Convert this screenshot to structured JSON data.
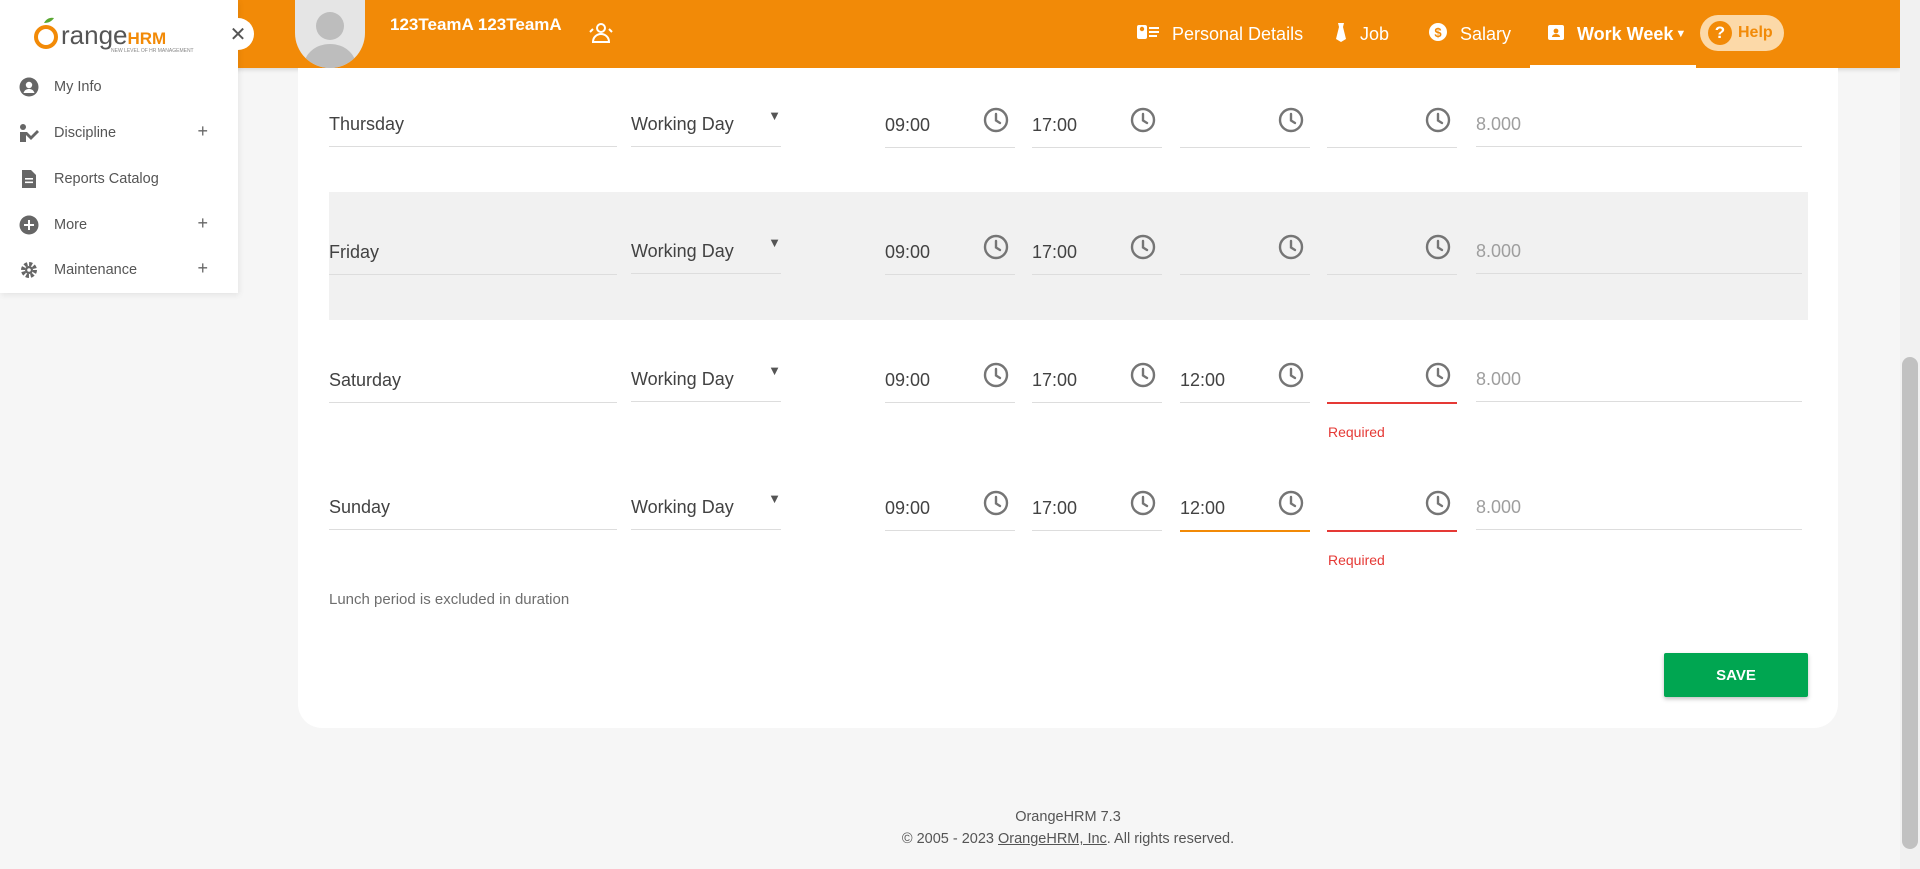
{
  "header": {
    "employee_name": "123TeamA 123TeamA",
    "nav": [
      {
        "label": "Personal Details",
        "icon": "personal-details-icon"
      },
      {
        "label": "Job",
        "icon": "job-icon"
      },
      {
        "label": "Salary",
        "icon": "salary-icon"
      },
      {
        "label": "Work Week",
        "icon": "work-week-icon",
        "active": true
      }
    ],
    "help_label": "Help"
  },
  "logo": {
    "text_orange": "Orange",
    "text_hrm": "HRM",
    "tagline": "NEW LEVEL OF HR MANAGEMENT"
  },
  "sidebar": {
    "items": [
      {
        "label": "My Info",
        "icon": "user-icon",
        "expandable": false
      },
      {
        "label": "Discipline",
        "icon": "discipline-icon",
        "expandable": true
      },
      {
        "label": "Reports Catalog",
        "icon": "document-icon",
        "expandable": false
      },
      {
        "label": "More",
        "icon": "plus-circle-icon",
        "expandable": true
      },
      {
        "label": "Maintenance",
        "icon": "gear-icon",
        "expandable": true
      }
    ]
  },
  "schedule": {
    "rows": [
      {
        "day": "Thursday",
        "type": "Working Day",
        "start": "09:00",
        "end": "17:00",
        "lunch_start": "",
        "lunch_end": "",
        "duration": "8.000"
      },
      {
        "day": "Friday",
        "type": "Working Day",
        "start": "09:00",
        "end": "17:00",
        "lunch_start": "",
        "lunch_end": "",
        "duration": "8.000"
      },
      {
        "day": "Saturday",
        "type": "Working Day",
        "start": "09:00",
        "end": "17:00",
        "lunch_start": "12:00",
        "lunch_end": "",
        "duration": "8.000",
        "error": "Required"
      },
      {
        "day": "Sunday",
        "type": "Working Day",
        "start": "09:00",
        "end": "17:00",
        "lunch_start": "12:00",
        "lunch_end": "",
        "duration": "8.000",
        "error": "Required"
      }
    ],
    "lunch_note": "Lunch period is excluded in duration",
    "save_label": "SAVE"
  },
  "footer": {
    "version": "OrangeHRM 7.3",
    "copyright_prefix": "© 2005 - 2023 ",
    "company_link": "OrangeHRM, Inc",
    "copyright_suffix": ". All rights reserved."
  },
  "colors": {
    "brand": "#f28a07",
    "save": "#00a651",
    "error": "#e53935"
  }
}
